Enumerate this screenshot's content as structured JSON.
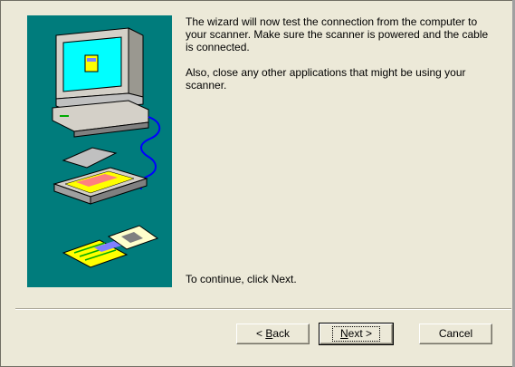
{
  "message": {
    "paragraph1": "The wizard will now test the connection from the computer to your scanner. Make sure the scanner is powered and the cable is connected.",
    "paragraph2": "Also, close any other applications that might be using your scanner.",
    "continue": "To continue, click Next."
  },
  "buttons": {
    "back_prefix": "< ",
    "back_mnemonic": "B",
    "back_rest": "ack",
    "next_mnemonic": "N",
    "next_rest": "ext >",
    "cancel": "Cancel"
  },
  "colors": {
    "panel": "#007c7c",
    "dialog": "#ece9d8"
  }
}
